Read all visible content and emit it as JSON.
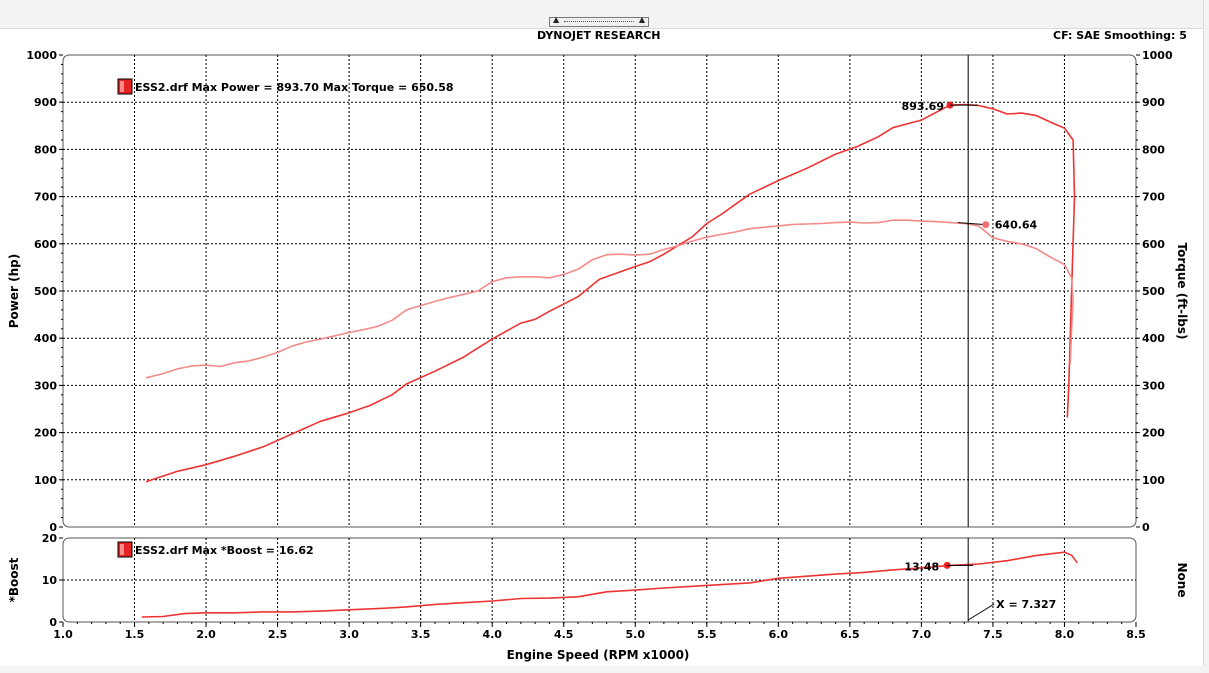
{
  "header": {
    "title": "DYNOJET RESEARCH",
    "corrections": "CF: SAE  Smoothing: 5",
    "splitter_arrow": "▲"
  },
  "chart_data": [
    {
      "type": "line",
      "xlabel": "Engine Speed (RPM x1000)",
      "ylabel": "Power (hp)",
      "y2label": "Torque (ft-lbs)",
      "xlim": [
        1.0,
        8.5
      ],
      "ylim": [
        0,
        1000
      ],
      "y2lim": [
        0,
        1000
      ],
      "x_ticks": [
        "1.0",
        "1.5",
        "2.0",
        "2.5",
        "3.0",
        "3.5",
        "4.0",
        "4.5",
        "5.0",
        "5.5",
        "6.0",
        "6.5",
        "7.0",
        "7.5",
        "8.0",
        "8.5"
      ],
      "y_ticks": [
        "0",
        "100",
        "200",
        "300",
        "400",
        "500",
        "600",
        "700",
        "800",
        "900",
        "1000"
      ],
      "grid": true,
      "legend": "ESS2.drf Max Power = 893.70 Max Torque = 650.58",
      "series": [
        {
          "name": "Power",
          "color": "#ee3333",
          "points": [
            [
              1.58,
              96
            ],
            [
              1.8,
              118
            ],
            [
              2.0,
              132
            ],
            [
              2.2,
              150
            ],
            [
              2.4,
              170
            ],
            [
              2.6,
              197
            ],
            [
              2.8,
              224
            ],
            [
              3.0,
              242
            ],
            [
              3.15,
              258
            ],
            [
              3.3,
              280
            ],
            [
              3.4,
              303
            ],
            [
              3.6,
              330
            ],
            [
              3.8,
              360
            ],
            [
              4.0,
              398
            ],
            [
              4.2,
              432
            ],
            [
              4.3,
              440
            ],
            [
              4.4,
              457
            ],
            [
              4.6,
              488
            ],
            [
              4.75,
              525
            ],
            [
              5.0,
              552
            ],
            [
              5.1,
              562
            ],
            [
              5.2,
              578
            ],
            [
              5.4,
              615
            ],
            [
              5.5,
              643
            ],
            [
              5.6,
              662
            ],
            [
              5.8,
              705
            ],
            [
              6.0,
              734
            ],
            [
              6.2,
              760
            ],
            [
              6.4,
              790
            ],
            [
              6.55,
              806
            ],
            [
              6.7,
              827
            ],
            [
              6.8,
              846
            ],
            [
              6.9,
              854
            ],
            [
              7.0,
              862
            ],
            [
              7.1,
              878
            ],
            [
              7.2,
              893.69
            ],
            [
              7.3,
              895
            ],
            [
              7.4,
              893
            ],
            [
              7.5,
              886
            ],
            [
              7.6,
              875
            ],
            [
              7.7,
              877
            ],
            [
              7.8,
              872
            ],
            [
              7.9,
              858
            ],
            [
              8.0,
              845
            ],
            [
              8.06,
              820
            ],
            [
              8.07,
              700
            ],
            [
              8.05,
              500
            ],
            [
              8.03,
              300
            ],
            [
              8.02,
              232
            ]
          ]
        },
        {
          "name": "Torque",
          "color": "#f48a8a",
          "points": [
            [
              1.58,
              316
            ],
            [
              1.7,
              325
            ],
            [
              1.8,
              335
            ],
            [
              1.9,
              341
            ],
            [
              2.0,
              343
            ],
            [
              2.1,
              340
            ],
            [
              2.2,
              348
            ],
            [
              2.3,
              352
            ],
            [
              2.4,
              360
            ],
            [
              2.5,
              370
            ],
            [
              2.6,
              383
            ],
            [
              2.7,
              392
            ],
            [
              2.8,
              398
            ],
            [
              2.9,
              405
            ],
            [
              3.0,
              412
            ],
            [
              3.1,
              418
            ],
            [
              3.2,
              425
            ],
            [
              3.3,
              438
            ],
            [
              3.4,
              460
            ],
            [
              3.5,
              469
            ],
            [
              3.6,
              478
            ],
            [
              3.7,
              486
            ],
            [
              3.8,
              493
            ],
            [
              3.9,
              500
            ],
            [
              4.0,
              520
            ],
            [
              4.1,
              528
            ],
            [
              4.2,
              530
            ],
            [
              4.3,
              530
            ],
            [
              4.4,
              528
            ],
            [
              4.5,
              535
            ],
            [
              4.6,
              546
            ],
            [
              4.7,
              566
            ],
            [
              4.8,
              577
            ],
            [
              4.9,
              578
            ],
            [
              5.0,
              576
            ],
            [
              5.1,
              578
            ],
            [
              5.2,
              588
            ],
            [
              5.3,
              596
            ],
            [
              5.4,
              606
            ],
            [
              5.5,
              614
            ],
            [
              5.6,
              620
            ],
            [
              5.7,
              625
            ],
            [
              5.8,
              632
            ],
            [
              5.9,
              635
            ],
            [
              6.0,
              638
            ],
            [
              6.1,
              641
            ],
            [
              6.2,
              642
            ],
            [
              6.3,
              643
            ],
            [
              6.4,
              645
            ],
            [
              6.5,
              646
            ],
            [
              6.6,
              644
            ],
            [
              6.7,
              645
            ],
            [
              6.8,
              650
            ],
            [
              6.9,
              650
            ],
            [
              7.0,
              648
            ],
            [
              7.1,
              647
            ],
            [
              7.2,
              645
            ],
            [
              7.3,
              643
            ],
            [
              7.4,
              638
            ],
            [
              7.5,
              613
            ],
            [
              7.6,
              605
            ],
            [
              7.7,
              600
            ],
            [
              7.8,
              590
            ],
            [
              7.9,
              572
            ],
            [
              8.0,
              556
            ],
            [
              8.05,
              528
            ],
            [
              8.06,
              480
            ],
            [
              8.05,
              420
            ],
            [
              8.04,
              345
            ]
          ]
        }
      ],
      "annotations": [
        {
          "x": 7.2,
          "y": 893.69,
          "text": "893.69",
          "series": "Power"
        },
        {
          "x": 7.45,
          "y": 640.64,
          "text": "640.64",
          "series": "Torque"
        }
      ],
      "cursor_x": 7.327
    },
    {
      "type": "line",
      "ylabel": "*Boost",
      "y2label": "None",
      "xlim": [
        1.0,
        8.5
      ],
      "ylim": [
        0,
        20
      ],
      "y_ticks": [
        "0",
        "10",
        "20"
      ],
      "grid": true,
      "legend": "ESS2.drf Max *Boost = 16.62",
      "series": [
        {
          "name": "*Boost",
          "color": "#ee3333",
          "points": [
            [
              1.55,
              1.2
            ],
            [
              1.7,
              1.3
            ],
            [
              1.85,
              2.0
            ],
            [
              2.0,
              2.2
            ],
            [
              2.2,
              2.2
            ],
            [
              2.4,
              2.4
            ],
            [
              2.6,
              2.4
            ],
            [
              2.8,
              2.6
            ],
            [
              3.0,
              2.9
            ],
            [
              3.2,
              3.2
            ],
            [
              3.4,
              3.6
            ],
            [
              3.6,
              4.2
            ],
            [
              3.8,
              4.6
            ],
            [
              4.0,
              5.0
            ],
            [
              4.2,
              5.6
            ],
            [
              4.4,
              5.7
            ],
            [
              4.6,
              6.0
            ],
            [
              4.8,
              7.2
            ],
            [
              5.0,
              7.6
            ],
            [
              5.2,
              8.1
            ],
            [
              5.4,
              8.5
            ],
            [
              5.6,
              8.9
            ],
            [
              5.8,
              9.3
            ],
            [
              6.0,
              10.4
            ],
            [
              6.2,
              10.9
            ],
            [
              6.4,
              11.4
            ],
            [
              6.6,
              11.8
            ],
            [
              6.8,
              12.4
            ],
            [
              7.0,
              12.9
            ],
            [
              7.2,
              13.48
            ],
            [
              7.4,
              13.8
            ],
            [
              7.6,
              14.6
            ],
            [
              7.8,
              15.8
            ],
            [
              8.0,
              16.62
            ],
            [
              8.05,
              15.9
            ],
            [
              8.09,
              14.1
            ]
          ]
        }
      ],
      "annotations": [
        {
          "x": 7.18,
          "y": 13.48,
          "text": "13.48",
          "series": "*Boost"
        }
      ],
      "cursor_label": "X = 7.327"
    }
  ]
}
